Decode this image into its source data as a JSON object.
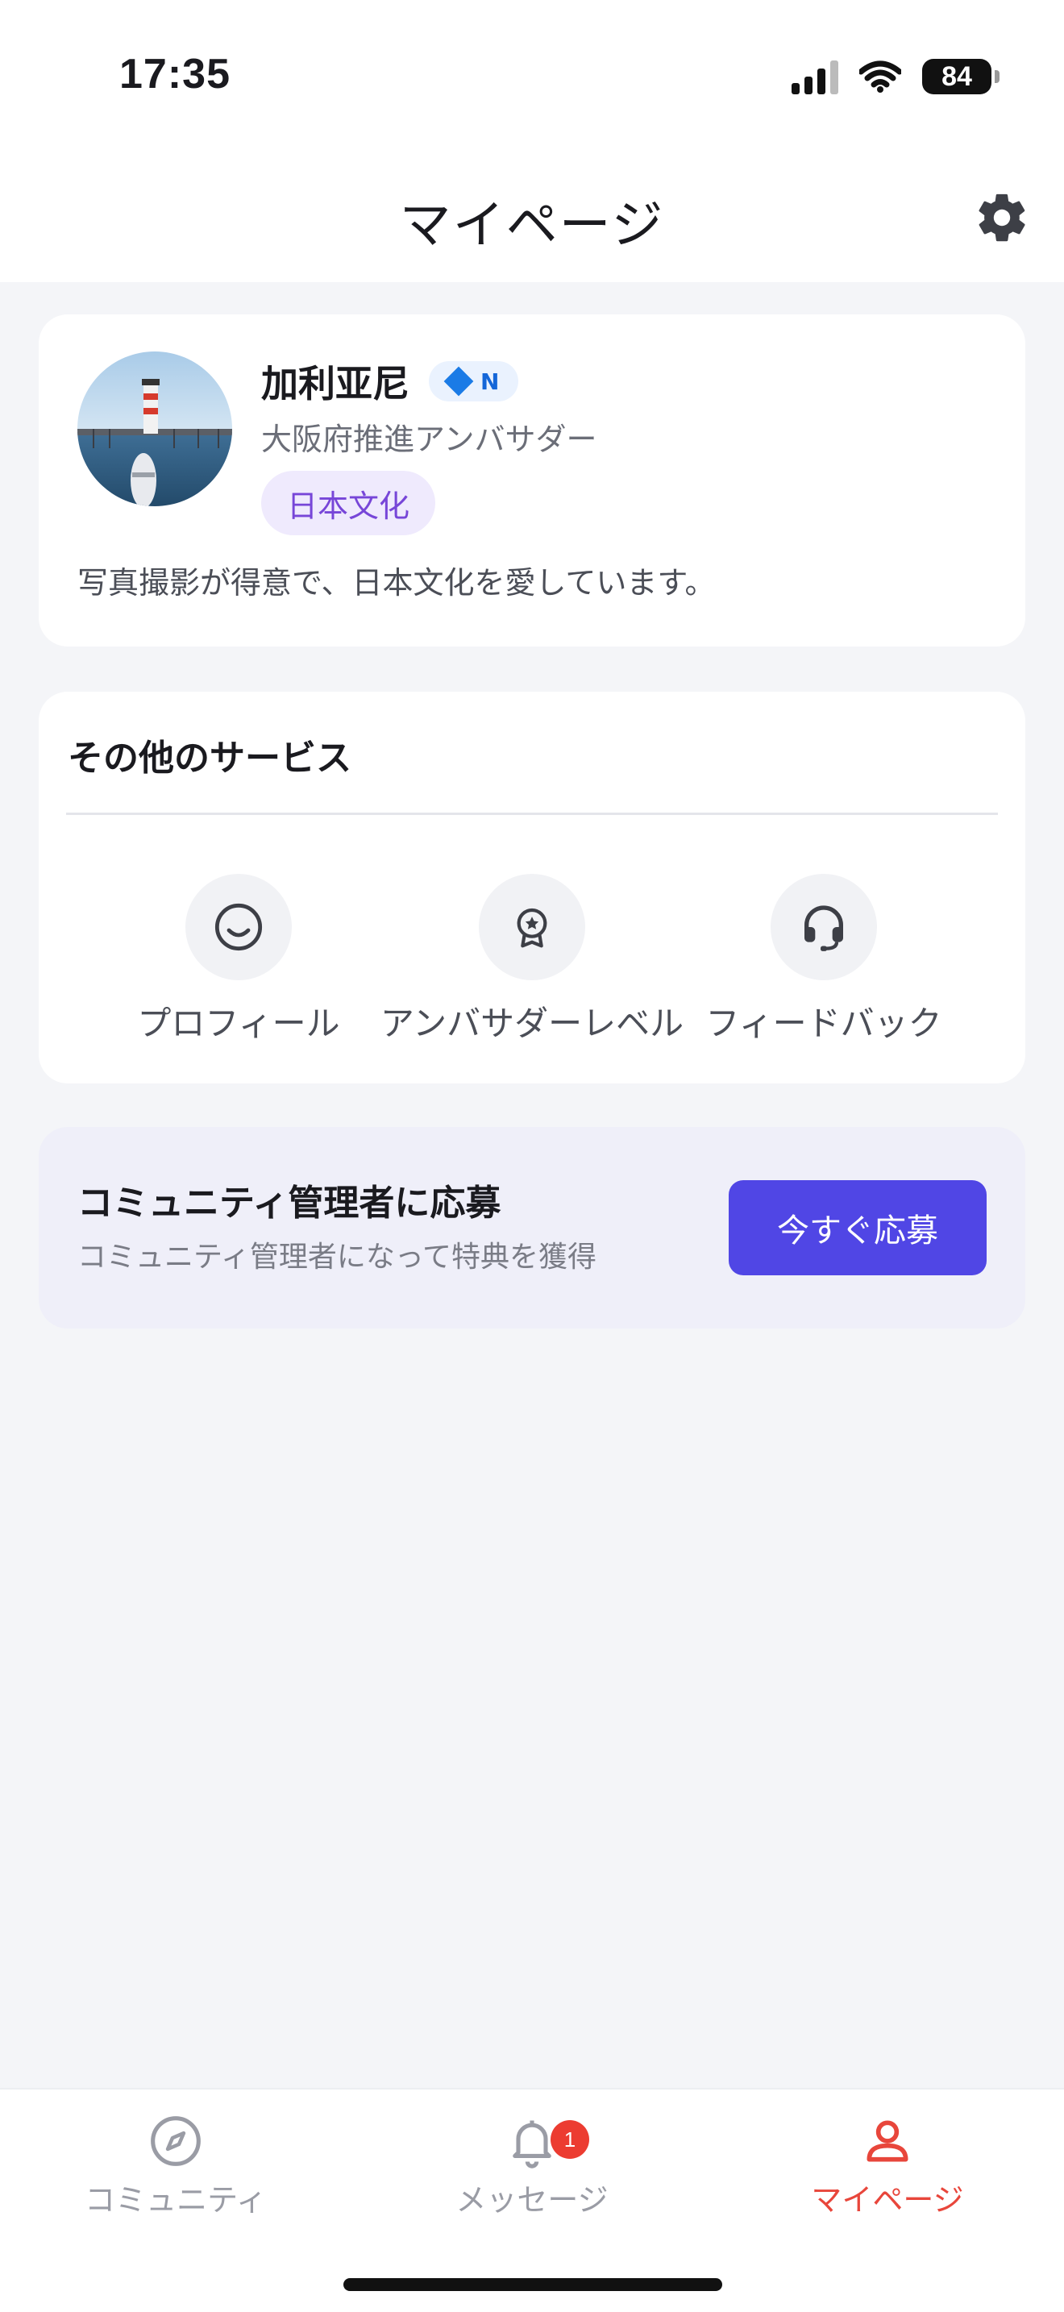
{
  "status_bar": {
    "time": "17:35",
    "battery": "84"
  },
  "header": {
    "title": "マイページ"
  },
  "profile": {
    "name": "加利亚尼",
    "level_badge": "N",
    "role": "大阪府推進アンバサダー",
    "tag": "日本文化",
    "bio": "写真撮影が得意で、日本文化を愛しています。"
  },
  "services": {
    "title": "その他のサービス",
    "items": [
      {
        "label": "プロフィール",
        "icon": "smile-icon"
      },
      {
        "label": "アンバサダーレベル",
        "icon": "award-icon"
      },
      {
        "label": "フィードバック",
        "icon": "headset-icon"
      }
    ]
  },
  "banner": {
    "title": "コミュニティ管理者に応募",
    "subtitle": "コミュニティ管理者になって特典を獲得",
    "button": "今すぐ応募"
  },
  "tabbar": {
    "items": [
      {
        "label": "コミュニティ",
        "icon": "compass-icon"
      },
      {
        "label": "メッセージ",
        "icon": "bell-icon",
        "badge": "1"
      },
      {
        "label": "マイページ",
        "icon": "person-icon",
        "active": true
      }
    ]
  },
  "colors": {
    "accent": "#5046e5",
    "active_tab": "#e8463b",
    "badge": "#ec3c31"
  }
}
